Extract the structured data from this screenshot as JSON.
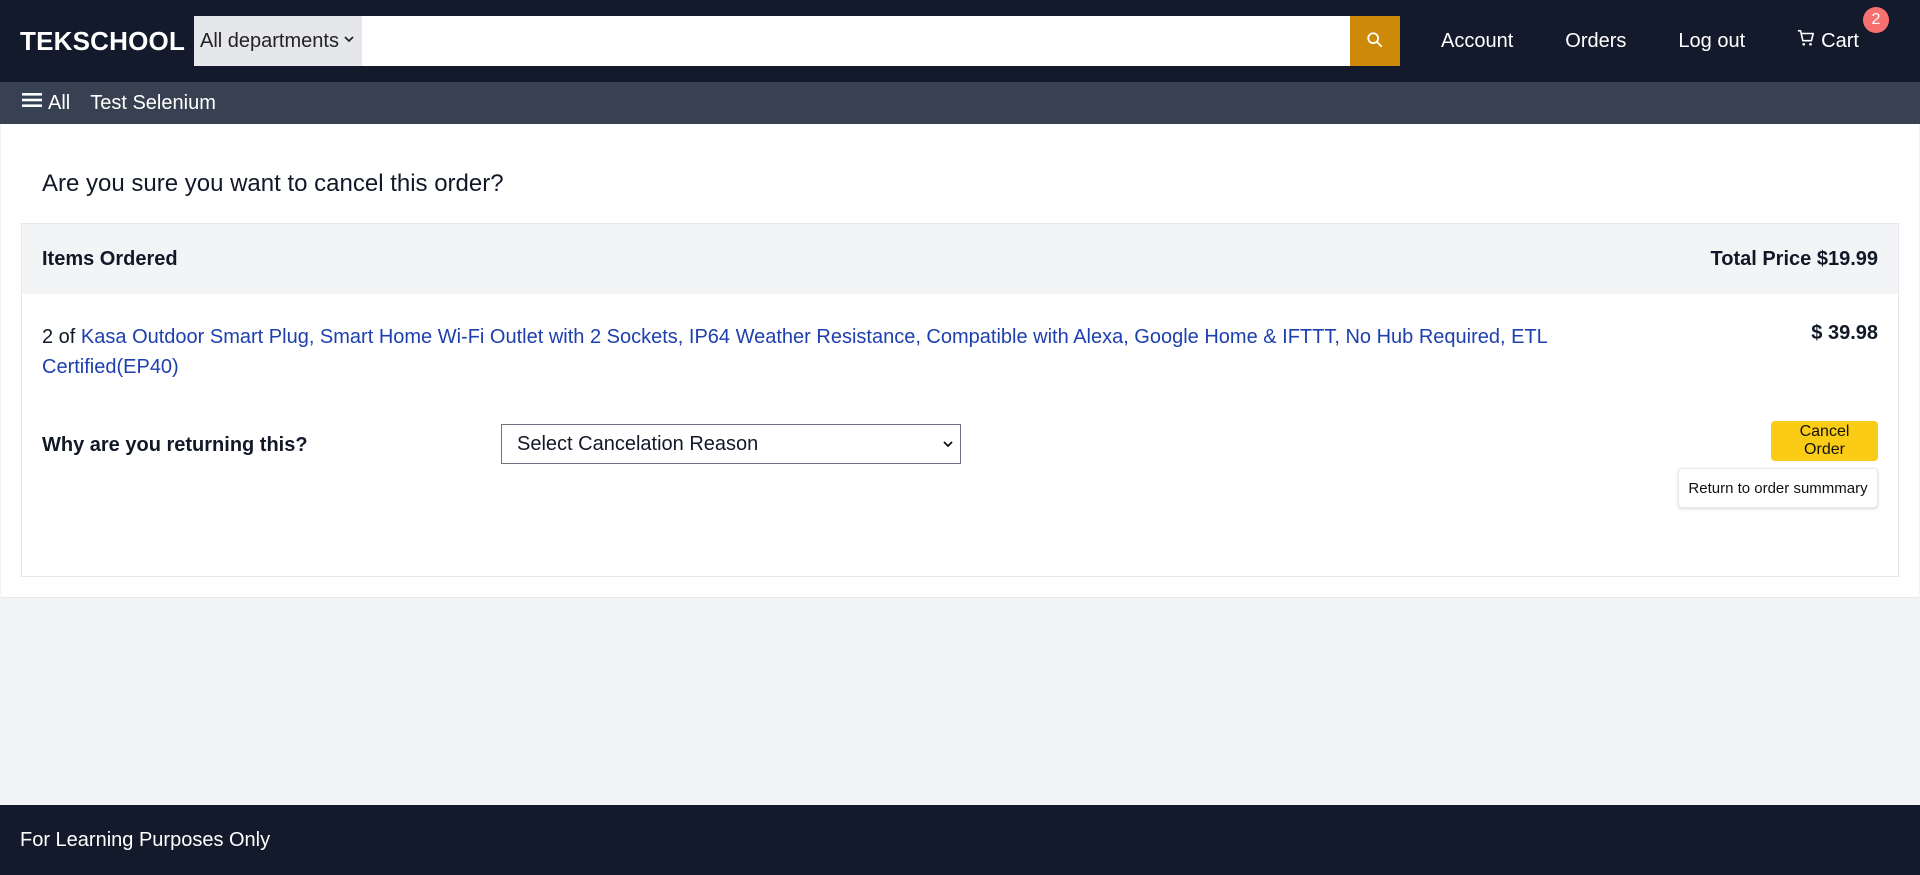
{
  "header": {
    "logo": "TEKSCHOOL",
    "departments_selected": "All departments",
    "search_placeholder": "",
    "nav": {
      "account": "Account",
      "orders": "Orders",
      "logout": "Log out",
      "cart": "Cart",
      "cart_count": "2"
    }
  },
  "subnav": {
    "all_label": "All",
    "items": [
      "Test Selenium"
    ]
  },
  "main": {
    "confirm_title": "Are you sure you want to cancel this order?",
    "order_head": {
      "items_label": "Items Ordered",
      "total_label": "Total Price $19.99"
    },
    "item": {
      "qty": "2 of",
      "name": "Kasa Outdoor Smart Plug, Smart Home Wi-Fi Outlet with 2 Sockets, IP64 Weather Resistance, Compatible with Alexa, Google Home & IFTTT, No Hub Required, ETL Certified(EP40)",
      "price": "$ 39.98"
    },
    "reason": {
      "label": "Why are you returning this?",
      "selected": "Select Cancelation Reason"
    },
    "buttons": {
      "cancel_order": "Cancel Order",
      "return_summary": "Return to order summmary"
    }
  },
  "footer": {
    "text": "For Learning Purposes Only"
  },
  "colors": {
    "header_bg": "#131a2c",
    "subnav_bg": "#374151",
    "search_button": "#cc8a08",
    "cancel_button": "#facc15",
    "link": "#1e40af",
    "badge": "#f87171"
  }
}
